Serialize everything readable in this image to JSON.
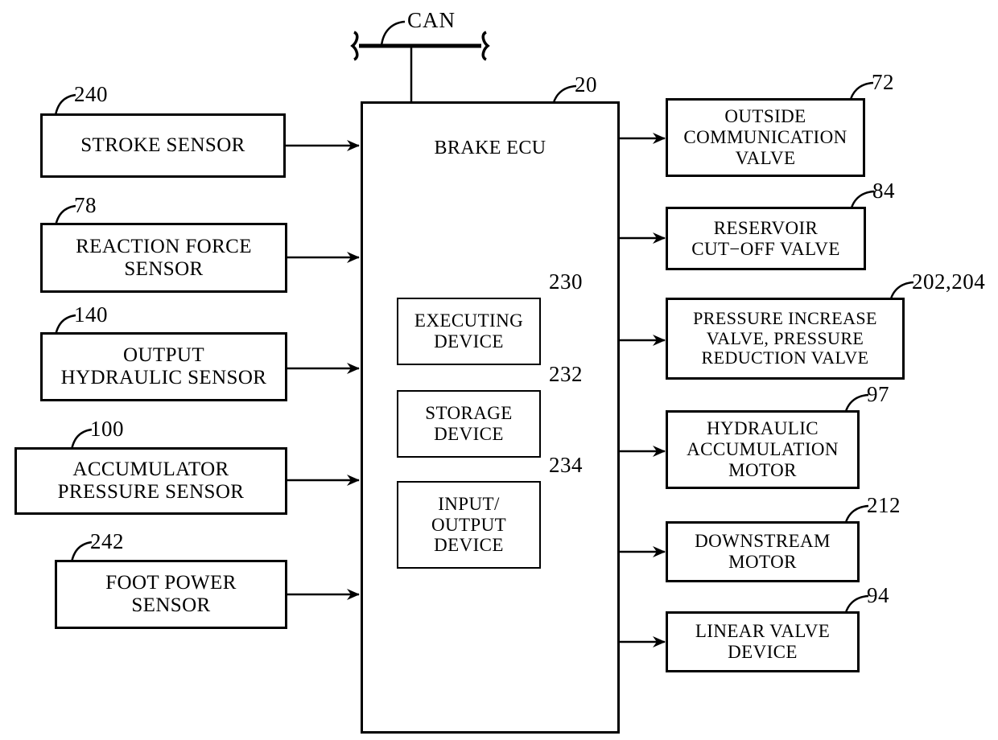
{
  "figure": {
    "type": "patent-block-diagram",
    "bus": {
      "label": "CAN",
      "name": "can-bus"
    },
    "controller": {
      "label": "BRAKE ECU",
      "ref": "20",
      "inner_modules": [
        {
          "label": "EXECUTING\nDEVICE",
          "ref": "230"
        },
        {
          "label": "STORAGE\nDEVICE",
          "ref": "232"
        },
        {
          "label": "INPUT/\nOUTPUT\nDEVICE",
          "ref": "234"
        }
      ]
    },
    "inputs": [
      {
        "label": "STROKE SENSOR",
        "ref": "240"
      },
      {
        "label": "REACTION FORCE\nSENSOR",
        "ref": "78"
      },
      {
        "label": "OUTPUT\nHYDRAULIC SENSOR",
        "ref": "140"
      },
      {
        "label": "ACCUMULATOR\nPRESSURE SENSOR",
        "ref": "100"
      },
      {
        "label": "FOOT POWER\nSENSOR",
        "ref": "242"
      }
    ],
    "outputs": [
      {
        "label": "OUTSIDE\nCOMMUNICATION\nVALVE",
        "ref": "72"
      },
      {
        "label": "RESERVOIR\nCUT−OFF VALVE",
        "ref": "84"
      },
      {
        "label": "PRESSURE INCREASE\nVALVE, PRESSURE\nREDUCTION VALVE",
        "ref": "202,204"
      },
      {
        "label": "HYDRAULIC\nACCUMULATION\nMOTOR",
        "ref": "97"
      },
      {
        "label": "DOWNSTREAM\nMOTOR",
        "ref": "212"
      },
      {
        "label": "LINEAR VALVE\nDEVICE",
        "ref": "94"
      }
    ],
    "colors": {
      "line": "#000000",
      "background": "#ffffff"
    }
  }
}
